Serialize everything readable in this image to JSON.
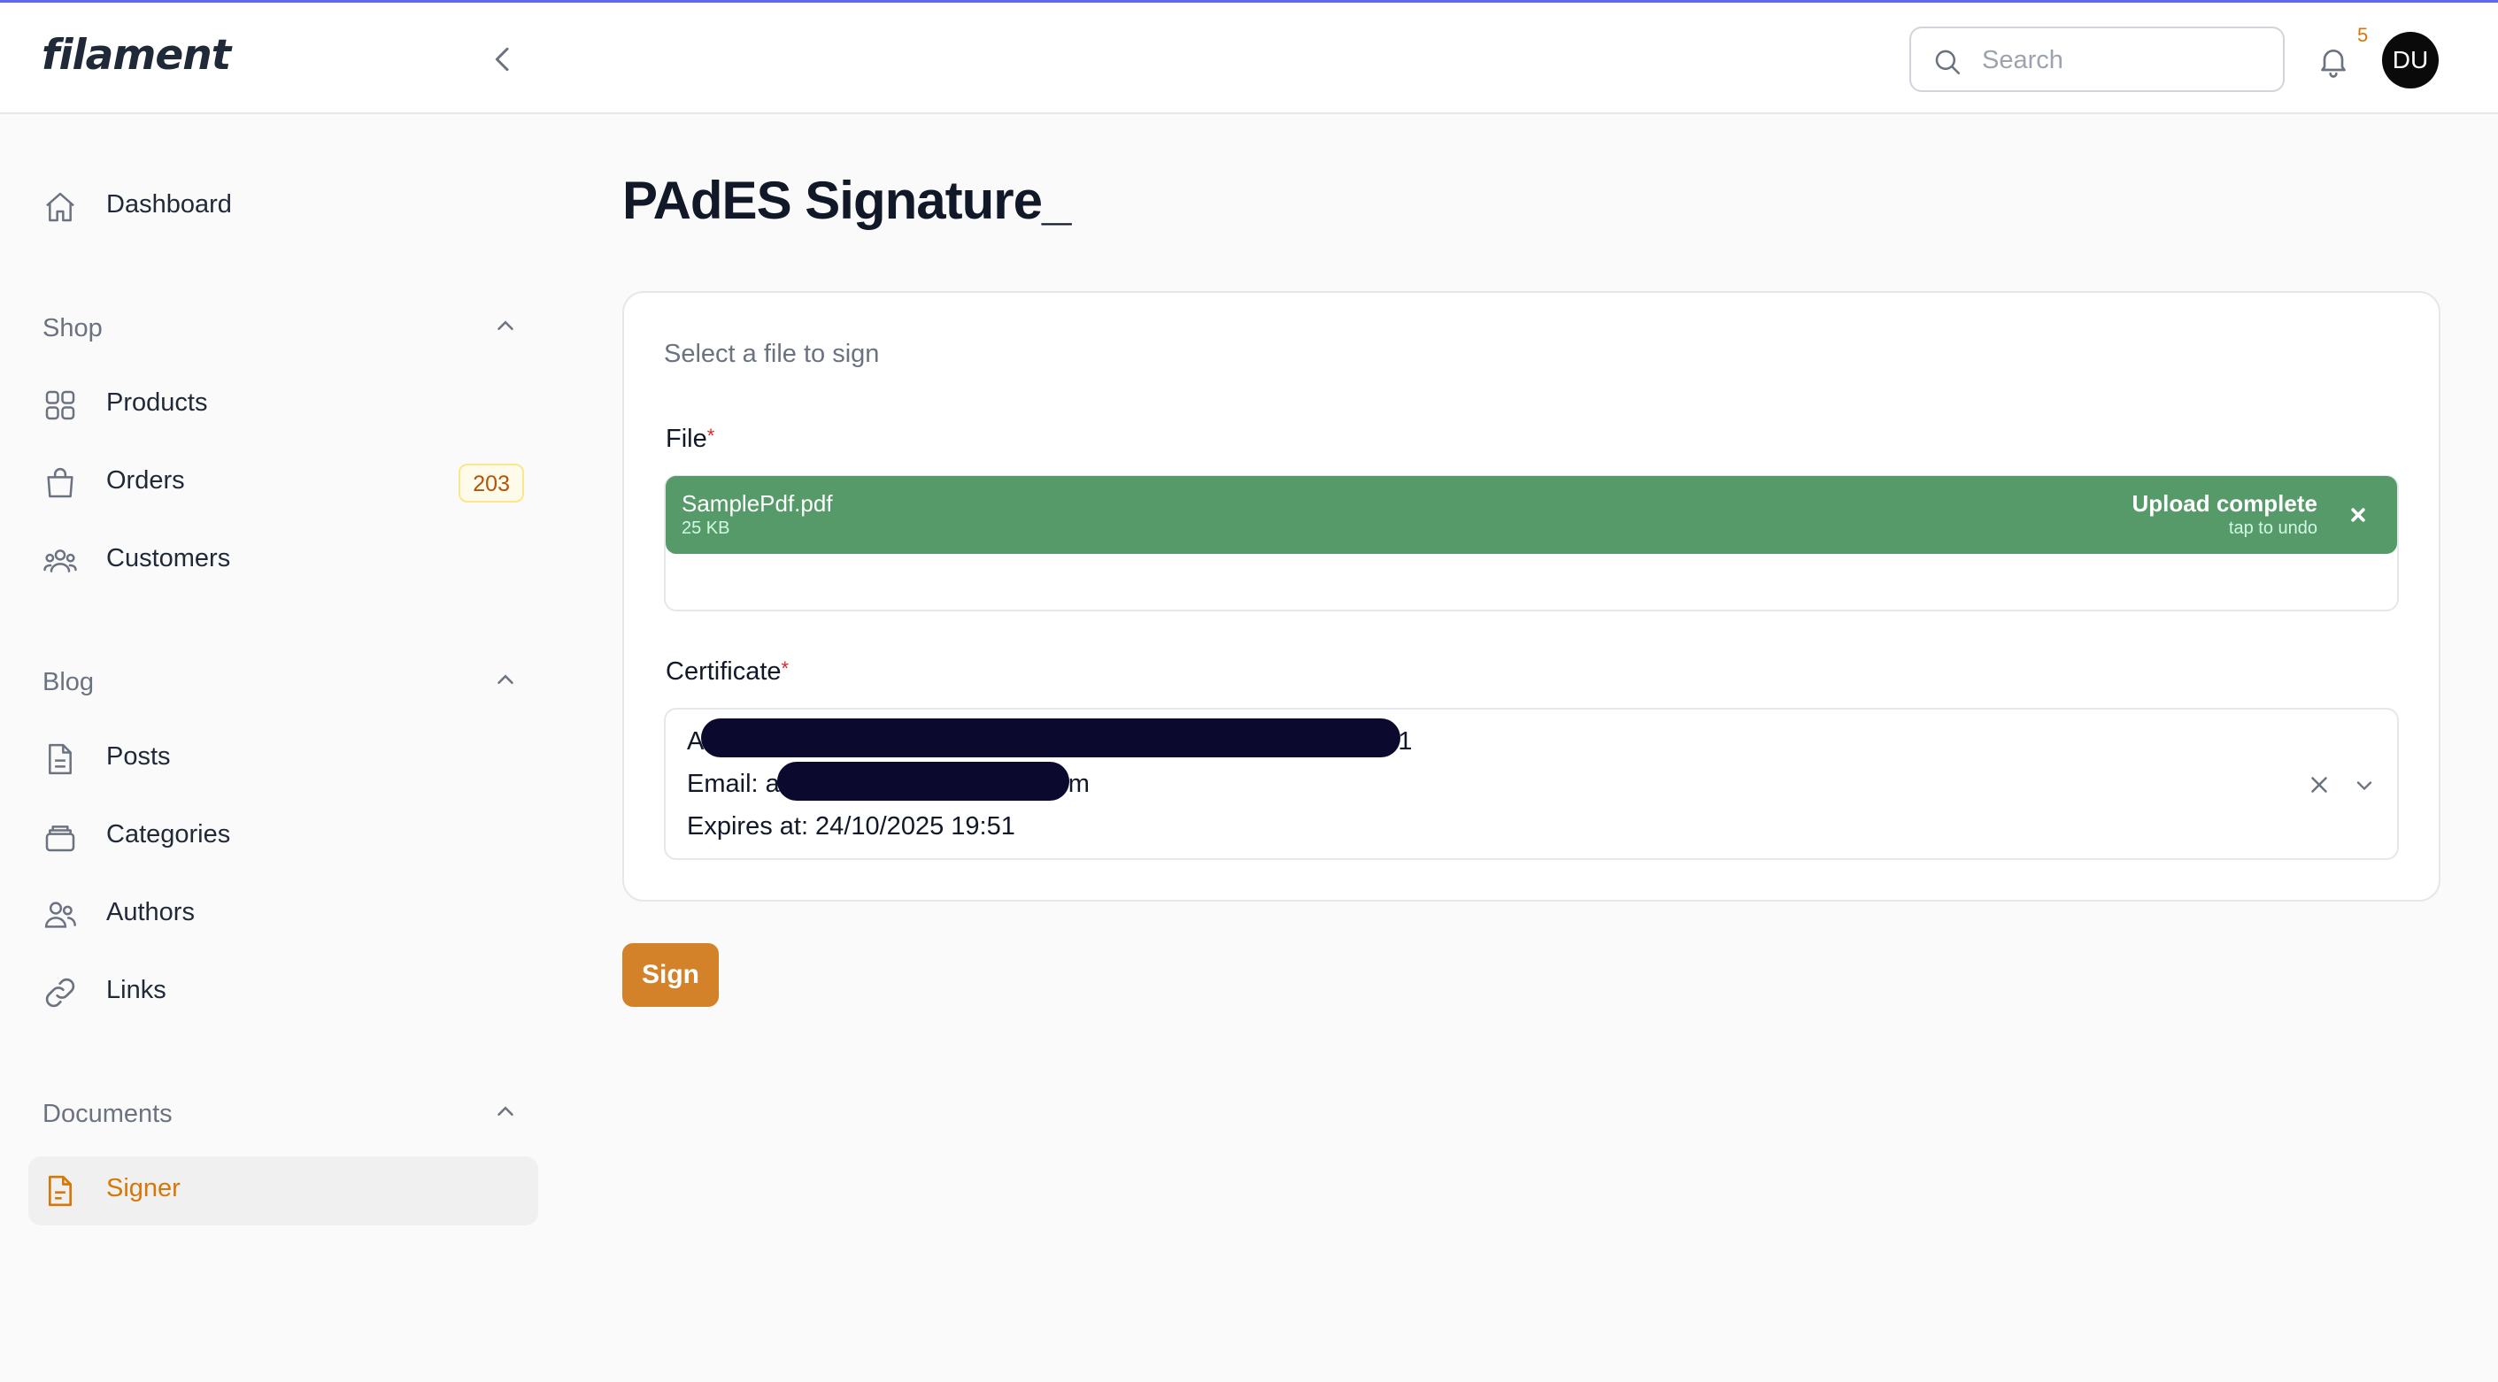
{
  "app": {
    "logo": "filament"
  },
  "header": {
    "search": {
      "placeholder": "Search",
      "value": ""
    },
    "notifications": {
      "count": "5"
    },
    "avatar": {
      "initials": "DU"
    }
  },
  "sidebar": {
    "dashboard": "Dashboard",
    "groups": [
      {
        "label": "Shop",
        "items": [
          {
            "label": "Products",
            "icon": "squares-icon"
          },
          {
            "label": "Orders",
            "icon": "shopping-bag-icon",
            "badge": "203"
          },
          {
            "label": "Customers",
            "icon": "users-icon"
          }
        ]
      },
      {
        "label": "Blog",
        "items": [
          {
            "label": "Posts",
            "icon": "document-icon"
          },
          {
            "label": "Categories",
            "icon": "stack-icon"
          },
          {
            "label": "Authors",
            "icon": "user-group-icon"
          },
          {
            "label": "Links",
            "icon": "link-icon"
          }
        ]
      },
      {
        "label": "Documents",
        "items": [
          {
            "label": "Signer",
            "icon": "document-text-icon",
            "active": true
          }
        ]
      }
    ]
  },
  "main": {
    "title": "PAdES Signature_",
    "description": "Select a file to sign",
    "file": {
      "label": "File",
      "required_mark": "*",
      "name": "SamplePdf.pdf",
      "size": "25 KB",
      "status": "Upload complete",
      "undo": "tap to undo"
    },
    "certificate": {
      "label": "Certificate",
      "required_mark": "*",
      "line1_start": "A",
      "line1_end": "1",
      "line2_start": "Email: a",
      "line2_end": "m",
      "line3": "Expires at: 24/10/2025 19:51"
    },
    "sign_button": "Sign"
  },
  "colors": {
    "accent": "#d97706",
    "primary_button": "#d4822a",
    "upload_success": "#559a68",
    "redaction": "#0b0a2e"
  }
}
